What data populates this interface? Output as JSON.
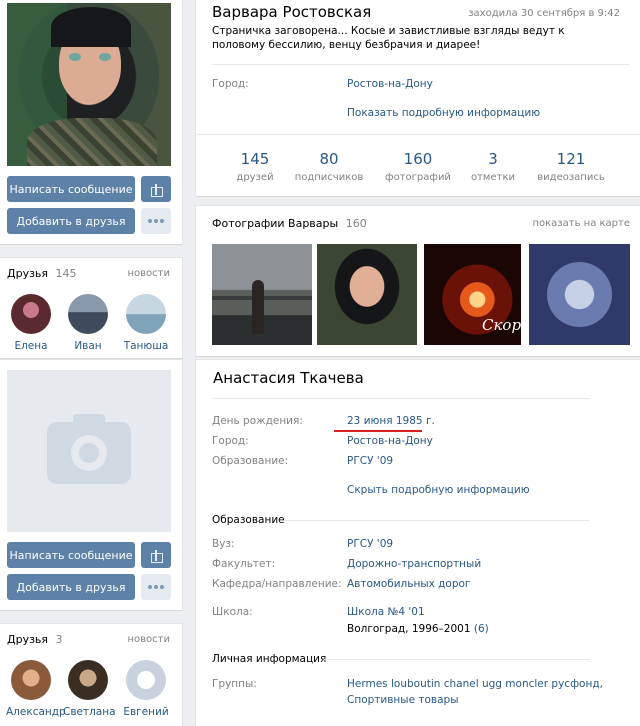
{
  "left": {
    "send_message": "Написать сообщение",
    "add_friend": "Добавить в друзья",
    "friends_title": "Друзья",
    "friends_count": "145",
    "friends_news": "новости",
    "friends": [
      {
        "name": "Елена",
        "color": "#5a2a2e"
      },
      {
        "name": "Иван",
        "color": "#3f4a5c"
      },
      {
        "name": "Танюша",
        "color": "#7fa3b8"
      }
    ],
    "send_message2": "Написать сообщение",
    "add_friend2": "Добавить в друзья",
    "friends2_title": "Друзья",
    "friends2_count": "3",
    "friends2_news": "новости",
    "friends2": [
      {
        "name": "Александр",
        "color": "#b07a55"
      },
      {
        "name": "Светлана",
        "color": "#6a5a3c"
      },
      {
        "name": "Евгений",
        "color": "#c9d2dc"
      }
    ]
  },
  "profile": {
    "name": "Варвара Ростовская",
    "last_seen": "заходила 30 сентября в 9:42",
    "status": "Страничка заговорена... Косые и завистливые взгляды ведут к половому бессилию, венцу безбрачия и диарее!",
    "city_label": "Город:",
    "city": "Ростов-на-Дону",
    "show_more": "Показать подробную информацию",
    "counters": [
      {
        "n": "145",
        "t": "друзей"
      },
      {
        "n": "80",
        "t": "подписчиков"
      },
      {
        "n": "160",
        "t": "фотографий"
      },
      {
        "n": "3",
        "t": "отметки"
      },
      {
        "n": "121",
        "t": "видеозапись"
      }
    ],
    "photos_title": "Фотографии Варвары",
    "photos_count": "160",
    "photos_map": "показать на карте",
    "photo4_caption": "Скорбим"
  },
  "profile2": {
    "name": "Анастасия Ткачева",
    "bday_label": "День рождения:",
    "bday": "23 июня 1985 г.",
    "city_label": "Город:",
    "city": "Ростов-на-Дону",
    "edu_label": "Образование:",
    "edu": "РГСУ '09",
    "hide_more": "Скрыть подробную информацию",
    "edu_section": "Образование",
    "uni_label": "Вуз:",
    "uni": "РГСУ '09",
    "faculty_label": "Факультет:",
    "faculty": "Дорожно-транспортный",
    "chair_label": "Кафедра/направление:",
    "chair": "Автомобильных дорог",
    "school_label": "Школа:",
    "school": "Школа №4 '01",
    "school_place": "Волгоград, 1996–2001",
    "school_count": "(6)",
    "personal_section": "Личная информация",
    "groups_label": "Группы:",
    "groups_line1": "Hermes louboutin chanel ugg moncler русфонд,",
    "groups_line2": "Спортивные товары"
  }
}
